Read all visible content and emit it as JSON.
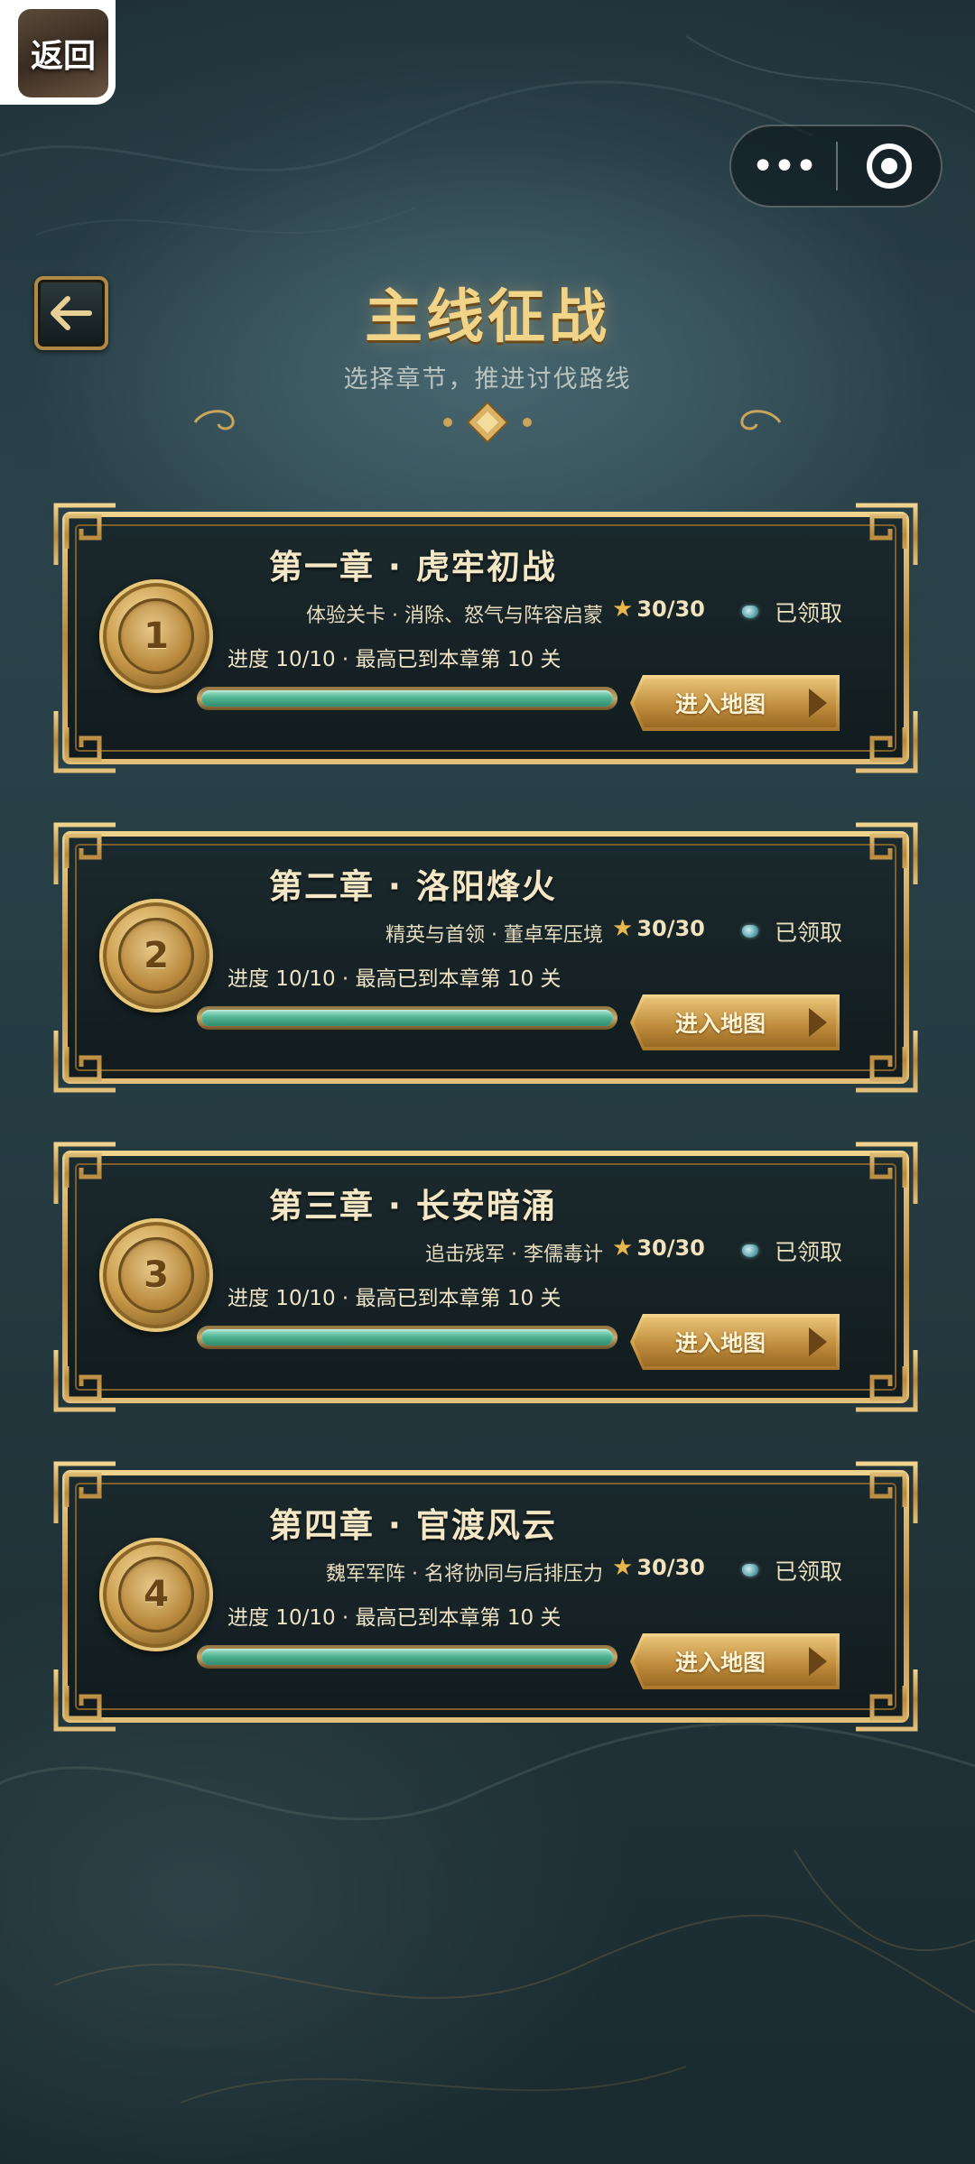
{
  "wechat": {
    "back_label": "返回",
    "menu_icon": "more-dots-icon",
    "close_icon": "miniprogram-close-icon"
  },
  "header": {
    "back_icon": "arrow-left-icon",
    "title": "主线征战",
    "subtitle": "选择章节，推进讨伐路线"
  },
  "colors": {
    "gold": "#f2d489",
    "progress_green": "#54b594",
    "frame_gold": "#c9a55c",
    "panel_dark": "#142024"
  },
  "chapters": [
    {
      "number": "1",
      "title": "第一章 · 虎牢初战",
      "desc": "体验关卡 · 消除、怒气与阵容启蒙",
      "stars": "30/30",
      "claim": "已领取",
      "progress_text": "进度 10/10 · 最高已到本章第 10 关",
      "progress": 1.0,
      "button": "进入地图"
    },
    {
      "number": "2",
      "title": "第二章 · 洛阳烽火",
      "desc": "精英与首领 · 董卓军压境",
      "stars": "30/30",
      "claim": "已领取",
      "progress_text": "进度 10/10 · 最高已到本章第 10 关",
      "progress": 1.0,
      "button": "进入地图"
    },
    {
      "number": "3",
      "title": "第三章 · 长安暗涌",
      "desc": "追击残军 · 李儒毒计",
      "stars": "30/30",
      "claim": "已领取",
      "progress_text": "进度 10/10 · 最高已到本章第 10 关",
      "progress": 1.0,
      "button": "进入地图"
    },
    {
      "number": "4",
      "title": "第四章 · 官渡风云",
      "desc": "魏军军阵 · 名将协同与后排压力",
      "stars": "30/30",
      "claim": "已领取",
      "progress_text": "进度 10/10 · 最高已到本章第 10 关",
      "progress": 1.0,
      "button": "进入地图"
    }
  ]
}
